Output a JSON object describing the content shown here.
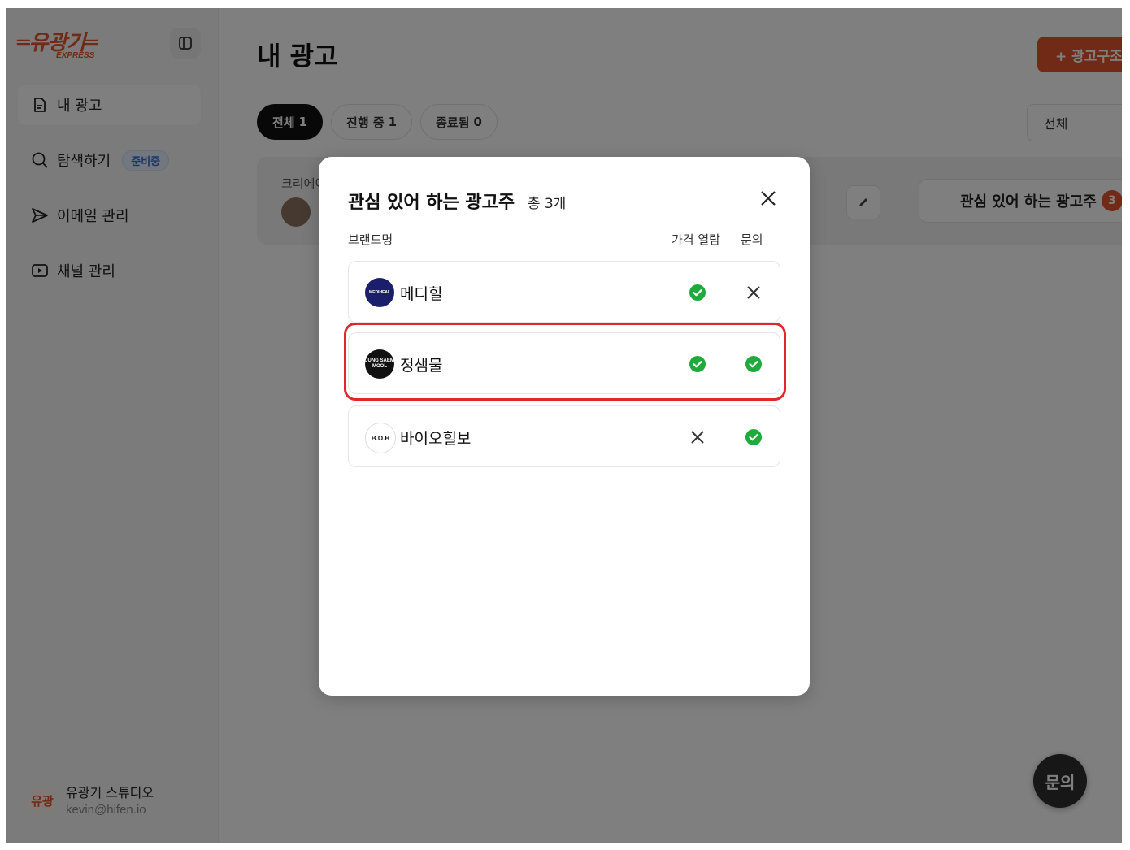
{
  "colors": {
    "accent": "#e0552b",
    "check_green": "#1faa3c",
    "highlight_red": "#e3262b"
  },
  "sidebar": {
    "logo_text": "═유광기═",
    "logo_sub": "EXPRESS",
    "collapse_icon": "sidebar-toggle-icon",
    "items": [
      {
        "label": "내 광고",
        "icon": "document-icon",
        "active": true
      },
      {
        "label": "탐색하기",
        "icon": "search-icon",
        "badge": "준비중"
      },
      {
        "label": "이메일 관리",
        "icon": "send-icon"
      },
      {
        "label": "채널 관리",
        "icon": "play-icon"
      }
    ],
    "user": {
      "avatar_text": "유광",
      "name": "유광기 스튜디오",
      "email": "kevin@hifen.io"
    }
  },
  "main": {
    "title": "내 광고",
    "create_button": "+ 광고구조",
    "tabs": [
      {
        "label": "전체",
        "count": "1",
        "active": true
      },
      {
        "label": "진행 중",
        "count": "1"
      },
      {
        "label": "종료됨",
        "count": "0"
      }
    ],
    "filter_select": "전체",
    "ad_card": {
      "creator_label": "크리에이",
      "interest_button": "관심 있어 하는 광고주",
      "interest_count": "3"
    },
    "fab_label": "문의"
  },
  "modal": {
    "title": "관심 있어 하는 광고주",
    "total": "총 3개",
    "columns": {
      "brand": "브랜드명",
      "price_view": "가격 열람",
      "inquiry": "문의"
    },
    "rows": [
      {
        "logo_text": "MEDIHEAL",
        "name": "메디힐",
        "price_view": true,
        "inquiry": false
      },
      {
        "logo_text": "JUNG SAEM MOOL",
        "name": "정샘물",
        "price_view": true,
        "inquiry": true
      },
      {
        "logo_text": "B.O.H",
        "name": "바이오힐보",
        "price_view": false,
        "inquiry": true
      }
    ]
  }
}
